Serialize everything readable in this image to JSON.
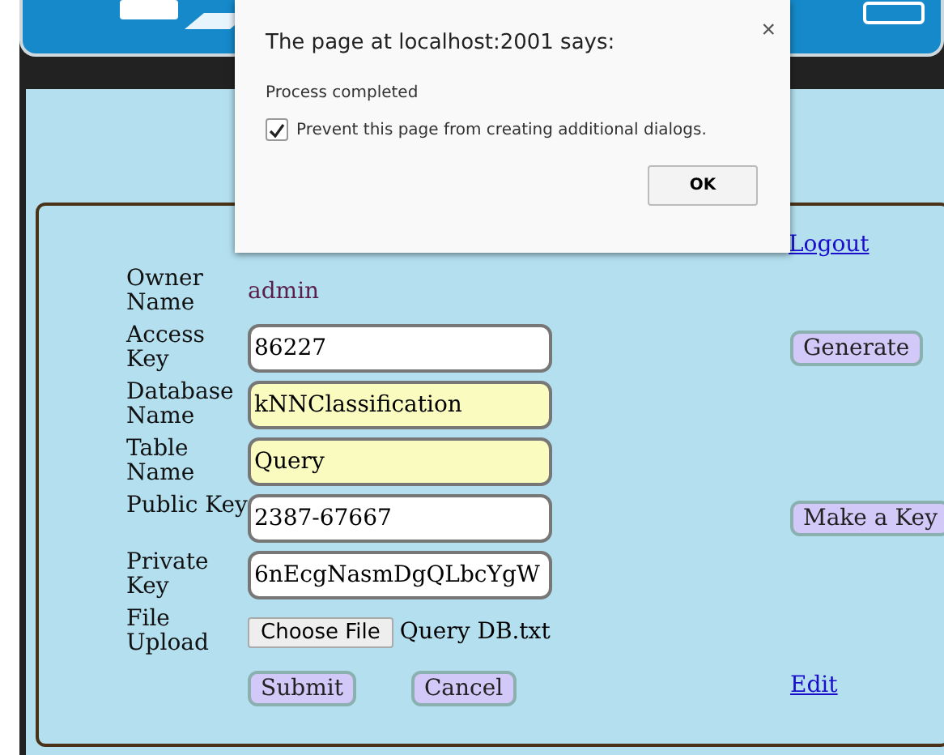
{
  "dialog": {
    "title": "The page at localhost:2001 says:",
    "close": "×",
    "message": "Process completed",
    "checkbox": {
      "label": "Prevent this page from creating additional dialogs.",
      "checked": true
    },
    "ok_button": "OK"
  },
  "logout_link": "Logout",
  "form": [
    {
      "kind": "text",
      "label": "Owner Name",
      "value": "admin"
    },
    {
      "kind": "field",
      "label": "Access Key",
      "value": "86227",
      "highlighted": false,
      "button": "Generate"
    },
    {
      "kind": "field",
      "label": "Database Name",
      "value": "kNNClassification",
      "highlighted": true
    },
    {
      "kind": "field",
      "label": "Table Name",
      "value": "Query",
      "highlighted": true
    },
    {
      "kind": "field",
      "label": "Public Key",
      "value": "2387-67667",
      "highlighted": false,
      "button": "Make a Key"
    },
    {
      "kind": "field",
      "label": "Private Key",
      "value": "6nEcgNasmDgQLbcYgW",
      "highlighted": false
    },
    {
      "kind": "file",
      "label": "File Upload",
      "button": "Choose File",
      "value": "Query DB.txt"
    }
  ],
  "actions": [
    "Submit",
    "Cancel"
  ],
  "edit_link": "Edit"
}
